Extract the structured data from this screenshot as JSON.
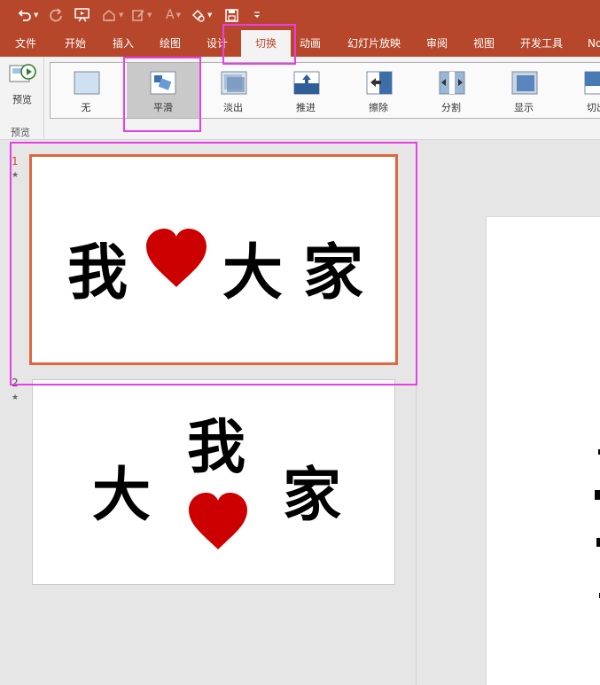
{
  "colors": {
    "accent": "#b7472a",
    "selected_slide_border": "#e0663e",
    "highlight": "#e83ee8",
    "heart": "#cc0000"
  },
  "quick_access": {
    "icons": [
      "undo-icon",
      "redo-icon",
      "present-from-start-icon",
      "format-painter-icon",
      "pen-icon",
      "font-color-icon",
      "shape-icon",
      "save-icon",
      "customize-icon"
    ],
    "font_glyph": "A"
  },
  "tabs": [
    {
      "label": "文件"
    },
    {
      "label": "开始"
    },
    {
      "label": "插入"
    },
    {
      "label": "绘图"
    },
    {
      "label": "设计"
    },
    {
      "label": "切换",
      "active": true
    },
    {
      "label": "动画"
    },
    {
      "label": "幻灯片放映"
    },
    {
      "label": "审阅"
    },
    {
      "label": "视图"
    },
    {
      "label": "开发工具"
    },
    {
      "label": "No"
    }
  ],
  "ribbon": {
    "preview_label": "预览",
    "preview_group_label": "预览",
    "transitions": [
      {
        "label": "无",
        "icon": "none-transition-icon"
      },
      {
        "label": "平滑",
        "icon": "morph-transition-icon",
        "selected": true
      },
      {
        "label": "淡出",
        "icon": "fade-transition-icon"
      },
      {
        "label": "推进",
        "icon": "push-transition-icon"
      },
      {
        "label": "擦除",
        "icon": "wipe-transition-icon"
      },
      {
        "label": "分割",
        "icon": "split-transition-icon"
      },
      {
        "label": "显示",
        "icon": "reveal-transition-icon"
      },
      {
        "label": "切出",
        "icon": "cut-transition-icon"
      }
    ]
  },
  "slides": [
    {
      "number": "1",
      "star": "★",
      "chars": [
        "我",
        "大",
        "家"
      ],
      "selected": true
    },
    {
      "number": "2",
      "star": "★",
      "chars": [
        "我",
        "大",
        "家"
      ]
    }
  ]
}
